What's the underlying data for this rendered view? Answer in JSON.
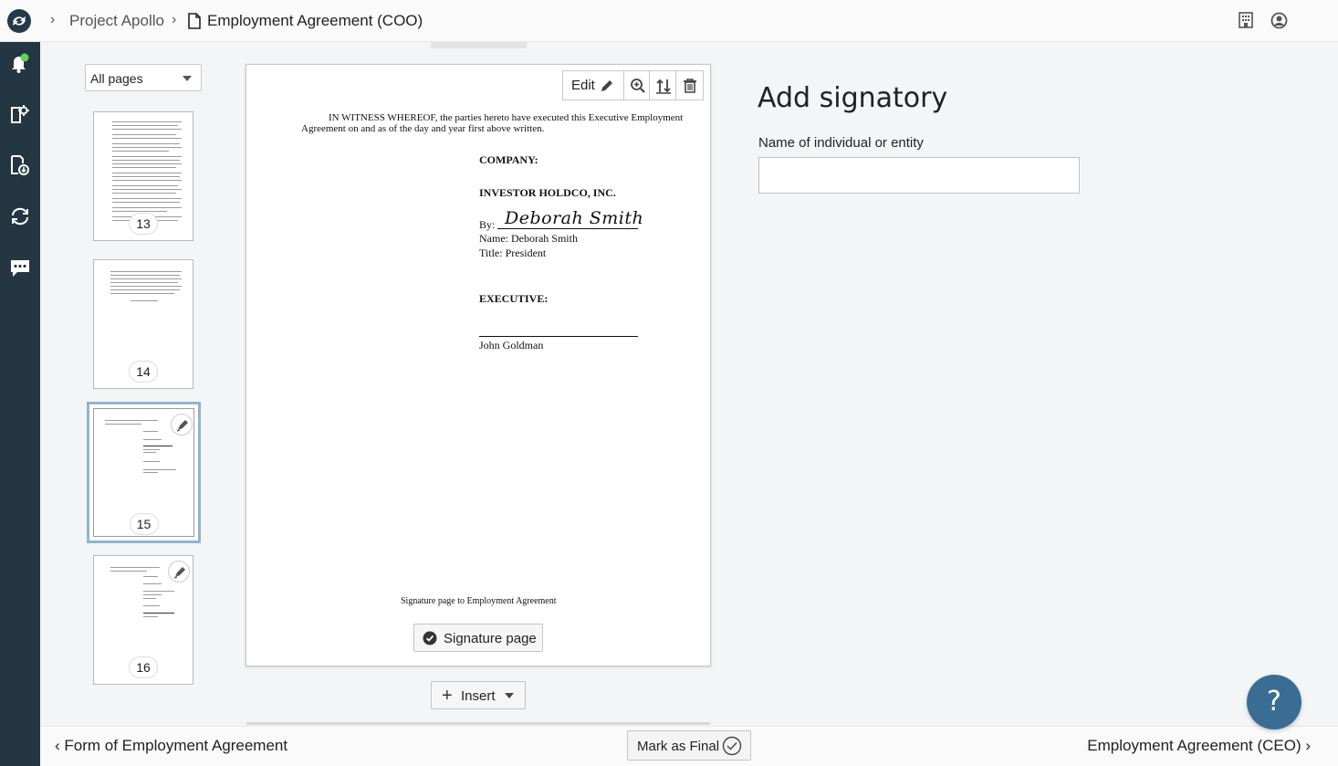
{
  "header": {
    "breadcrumb_project": "Project Apollo",
    "breadcrumb_document": "Employment Agreement (COO)",
    "icons": [
      "building-icon",
      "account-icon"
    ]
  },
  "rail": {
    "icons": [
      "notifications-icon",
      "settings-document-icon",
      "download-document-icon",
      "sync-icon",
      "chat-icon"
    ]
  },
  "thumbnails": {
    "filter_value": "All pages",
    "pages": [
      {
        "number": "13",
        "selected": false,
        "signature": false
      },
      {
        "number": "14",
        "selected": false,
        "signature": false
      },
      {
        "number": "15",
        "selected": true,
        "signature": true
      },
      {
        "number": "16",
        "selected": false,
        "signature": true
      }
    ]
  },
  "toolbar": {
    "edit_label": "Edit"
  },
  "document": {
    "witness_line1": "IN WITNESS WHEREOF, the parties hereto have executed this Executive Employment",
    "witness_line2": "Agreement on and as of the day and year first above written.",
    "company_heading": "COMPANY:",
    "company_name": "INVESTOR HOLDCO, INC.",
    "by_label": "By:",
    "signature": "Deborah Smith",
    "name_line": "Name: Deborah Smith",
    "title_line": "Title: President",
    "executive_heading": "EXECUTIVE:",
    "executive_name": "John Goldman",
    "footer": "Signature page to Employment Agreement"
  },
  "buttons": {
    "signature_page": "Signature page",
    "insert": "Insert",
    "mark_final": "Mark as Final"
  },
  "panel": {
    "title": "Add signatory",
    "field_label": "Name of individual or entity",
    "field_value": ""
  },
  "navigation": {
    "prev_label": "Form of Employment Agreement",
    "next_label": "Employment Agreement (CEO)"
  },
  "help_label": "?",
  "colors": {
    "rail": "#233642",
    "help": "#3a6d93",
    "selected_border": "#8fb4d0",
    "notification_dot": "#5fd35f"
  }
}
